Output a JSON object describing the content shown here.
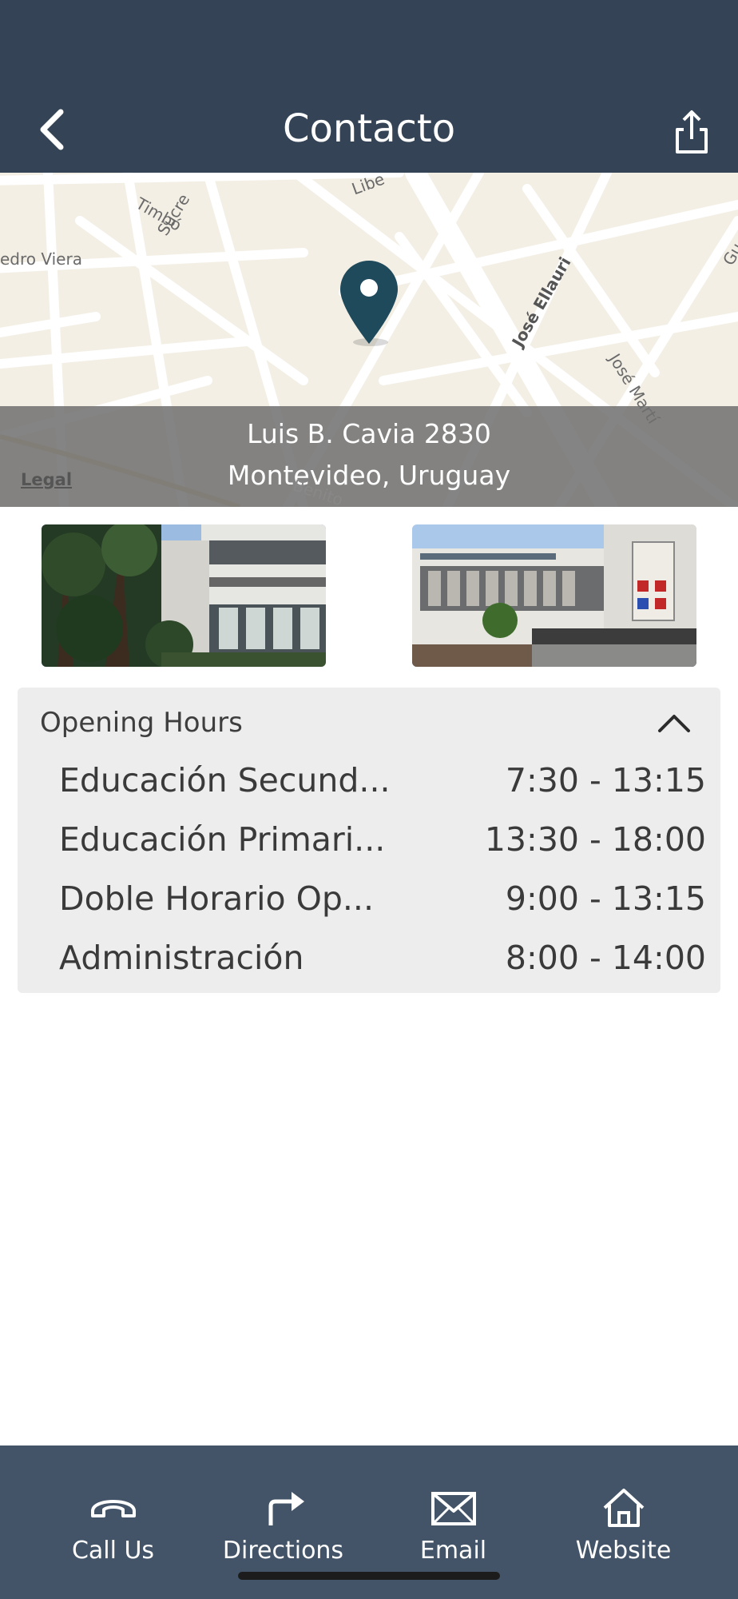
{
  "header": {
    "title": "Contacto",
    "back_icon": "chevron-left-icon",
    "share_icon": "share-icon"
  },
  "map": {
    "streets": [
      "Timbó",
      "Libe",
      "edro Viera",
      "Sucre",
      "José Ellauri",
      "José Martí",
      "Gu",
      "Benito"
    ],
    "legal_label": "Legal",
    "address_line1": "Luis B. Cavia 2830",
    "address_line2": "Montevideo, Uruguay",
    "pin_color": "#1e4a5c"
  },
  "opening_hours": {
    "heading": "Opening Hours",
    "rows": [
      {
        "name": "Educación Secund...",
        "time": "7:30 - 13:15"
      },
      {
        "name": "Educación Primari...",
        "time": "13:30 - 18:00"
      },
      {
        "name": "Doble Horario Op...",
        "time": "9:00 - 13:15"
      },
      {
        "name": "Administración",
        "time": "8:00 - 14:00"
      }
    ]
  },
  "tabbar": {
    "items": [
      {
        "label": "Call Us",
        "icon": "phone-icon"
      },
      {
        "label": "Directions",
        "icon": "directions-icon"
      },
      {
        "label": "Email",
        "icon": "email-icon"
      },
      {
        "label": "Website",
        "icon": "home-icon"
      }
    ]
  },
  "colors": {
    "header_bg": "#344456",
    "tabbar_bg": "#435468",
    "card_bg": "#ededed"
  }
}
